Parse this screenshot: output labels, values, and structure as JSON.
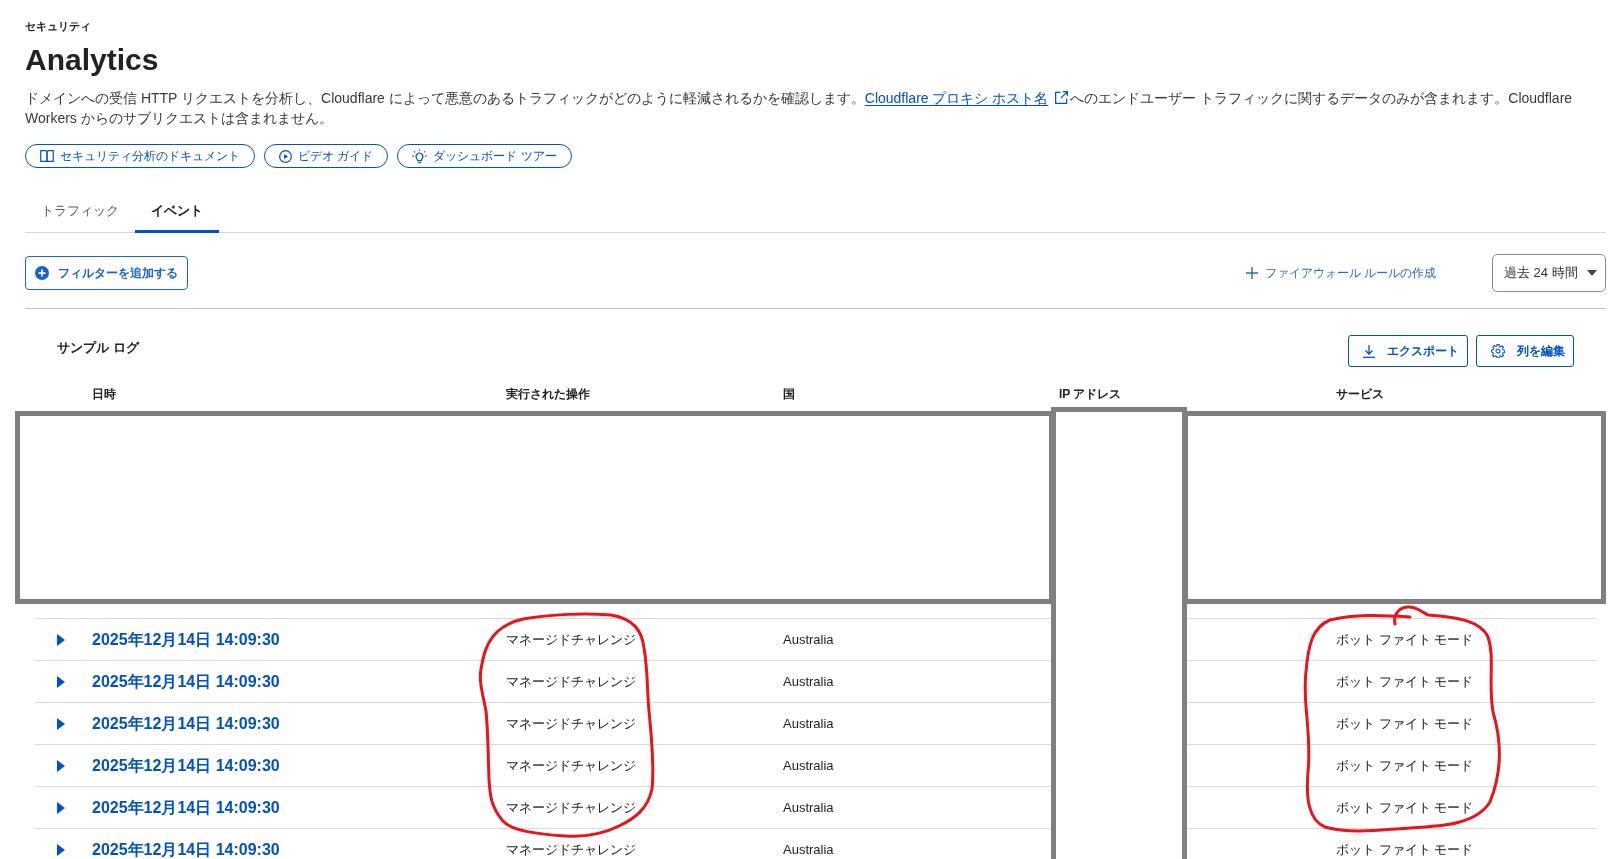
{
  "breadcrumb": "セキュリティ",
  "title": "Analytics",
  "description": {
    "before": "ドメインへの受信 HTTP リクエストを分析し、Cloudflare によって悪意のあるトラフィックがどのように軽減されるかを確認します。",
    "link": "Cloudflare プロキシ ホスト名",
    "after": "へのエンドユーザー トラフィックに関するデータのみが含まれます。Cloudflare Workers からのサブリクエストは含まれません。"
  },
  "help_links": [
    {
      "kind": "book",
      "label": "セキュリティ分析のドキュメント"
    },
    {
      "kind": "play",
      "label": "ビデオ ガイド"
    },
    {
      "kind": "bulb",
      "label": "ダッシュボード ツアー"
    }
  ],
  "tabs": [
    {
      "label": "トラフィック",
      "selected": false
    },
    {
      "label": "イベント",
      "selected": true
    }
  ],
  "toolbar": {
    "add_filter": "フィルターを追加する",
    "create_rule": "ファイアウォール ルールの作成",
    "time_range": "過去 24 時間"
  },
  "sample_log": {
    "title": "サンプル ログ",
    "buttons": [
      {
        "kind": "download",
        "label": "エクスポート"
      },
      {
        "kind": "settings",
        "label": "列を編集"
      }
    ],
    "columns": [
      "日時",
      "実行された操作",
      "国",
      "IP アドレス",
      "サービス"
    ],
    "rows": [
      {
        "expanded": false,
        "datetime": "2025年12月14日 14:09:30",
        "action": "マネージドチャレンジ",
        "country": "Australia",
        "service": "ボット ファイト モード"
      },
      {
        "expanded": false,
        "datetime": "2025年12月14日 14:09:30",
        "action": "マネージドチャレンジ",
        "country": "Australia",
        "service": "ボット ファイト モード"
      },
      {
        "expanded": false,
        "datetime": "2025年12月14日 14:09:30",
        "action": "マネージドチャレンジ",
        "country": "Australia",
        "service": "ボット ファイト モード"
      },
      {
        "expanded": false,
        "datetime": "2025年12月14日 14:09:30",
        "action": "マネージドチャレンジ",
        "country": "Australia",
        "service": "ボット ファイト モード"
      },
      {
        "expanded": false,
        "datetime": "2025年12月14日 14:09:30",
        "action": "マネージドチャレンジ",
        "country": "Australia",
        "service": "ボット ファイト モード"
      },
      {
        "expanded": false,
        "datetime": "2025年12月14日 14:09:30",
        "action": "マネージドチャレンジ",
        "country": "Australia",
        "service": "ボット ファイト モード"
      }
    ]
  }
}
